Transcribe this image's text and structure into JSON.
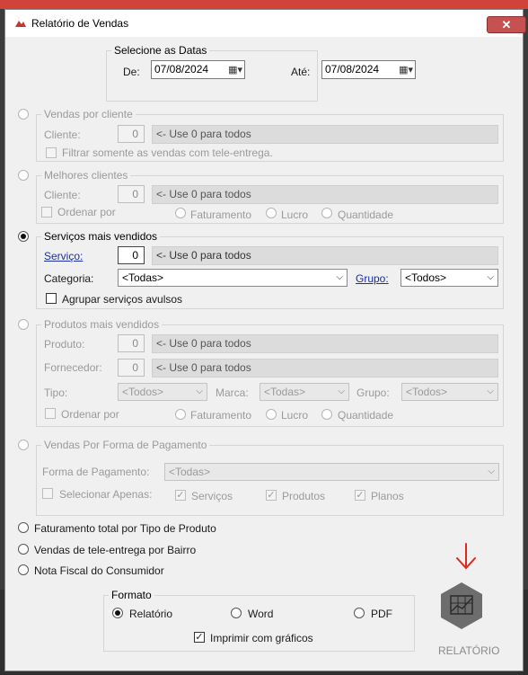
{
  "window": {
    "title": "Relatório de Vendas",
    "close": "✕"
  },
  "dates": {
    "legend": "Selecione as Datas",
    "from_label": "De:",
    "from_value": "07/08/2024",
    "to_label": "Até:",
    "to_value": "07/08/2024"
  },
  "hint": "<- Use 0 para todos",
  "vendas_cliente": {
    "legend": "Vendas por cliente",
    "cliente_label": "Cliente:",
    "cliente_value": "0",
    "filter_label": "Filtrar somente as vendas com tele-entrega."
  },
  "melhores": {
    "legend": "Melhores clientes",
    "cliente_label": "Cliente:",
    "cliente_value": "0",
    "ordenar_label": "Ordenar por",
    "opt1": "Faturamento",
    "opt2": "Lucro",
    "opt3": "Quantidade"
  },
  "servicos": {
    "legend": "Serviços mais vendidos",
    "servico_label": "Serviço:",
    "servico_value": "0",
    "categoria_label": "Categoria:",
    "categoria_value": "<Todas>",
    "grupo_label": "Grupo:",
    "grupo_value": "<Todos>",
    "agrupar_label": "Agrupar serviços avulsos"
  },
  "produtos": {
    "legend": "Produtos mais vendidos",
    "produto_label": "Produto:",
    "produto_value": "0",
    "fornecedor_label": "Fornecedor:",
    "fornecedor_value": "0",
    "tipo_label": "Tipo:",
    "tipo_value": "<Todos>",
    "marca_label": "Marca:",
    "marca_value": "<Todas>",
    "grupo_label": "Grupo:",
    "grupo_value": "<Todos>",
    "ordenar_label": "Ordenar por",
    "opt1": "Faturamento",
    "opt2": "Lucro",
    "opt3": "Quantidade"
  },
  "pagamento": {
    "legend": "Vendas Por Forma de Pagamento",
    "forma_label": "Forma de Pagamento:",
    "forma_value": "<Todas>",
    "selecionar_label": "Selecionar Apenas:",
    "opt1": "Serviços",
    "opt2": "Produtos",
    "opt3": "Planos"
  },
  "extra": {
    "faturamento_tipo": "Faturamento total por Tipo de Produto",
    "tele_bairro": "Vendas de tele-entrega por Bairro",
    "nota_fiscal": "Nota Fiscal do Consumidor"
  },
  "formato": {
    "legend": "Formato",
    "relatorio": "Relatório",
    "word": "Word",
    "pdf": "PDF",
    "graficos": "Imprimir com gráficos"
  },
  "report_button": {
    "label": "RELATÓRIO"
  },
  "colors": {
    "accent_red": "#d0433b",
    "report_hex": "#6d6d6d"
  }
}
